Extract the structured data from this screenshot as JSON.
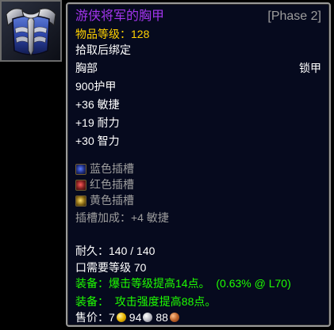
{
  "item": {
    "icon": "blue-armored-chest-icon",
    "name": "游侠将军的胸甲",
    "phase": "[Phase 2]",
    "item_level": "物品等级：128",
    "bind": "拾取后绑定",
    "slot": "胸部",
    "armor_type": "锁甲",
    "armor": "900护甲",
    "stats": [
      "+36 敏捷",
      "+19 耐力",
      "+30 智力"
    ],
    "sockets": [
      {
        "color": "blue",
        "label": "蓝色插槽"
      },
      {
        "color": "red",
        "label": "红色插槽"
      },
      {
        "color": "yellow",
        "label": "黄色插槽"
      }
    ],
    "socket_bonus": "插槽加成：+4 敏捷",
    "durability": "耐久：140 / 140",
    "required_level": "口需要等级 70",
    "equip_effects": [
      {
        "label": "装备：",
        "text": "爆击等级提高14点。",
        "extra": "(0.63% @ L70)"
      },
      {
        "label": "装备：",
        "text": " 攻击强度提高88点。",
        "extra": ""
      }
    ],
    "sell_price": {
      "label": "售价：",
      "gold": "7",
      "silver": "94",
      "copper": "88"
    }
  },
  "colors": {
    "epic": "#a335ee",
    "gold": "#ffd100",
    "grey": "#9d9d9d",
    "green": "#1eff00",
    "panel_bg": "#060a1e"
  }
}
